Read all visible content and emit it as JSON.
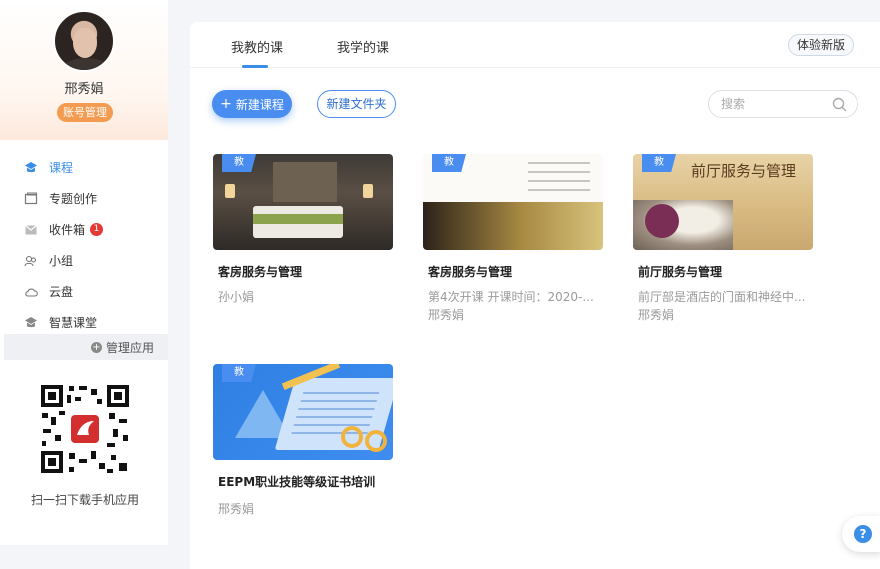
{
  "sidebar": {
    "user": {
      "name": "邢秀娟",
      "account_button": "账号管理"
    },
    "nav": [
      {
        "label": "课程",
        "icon": "course-icon",
        "active": true
      },
      {
        "label": "专题创作",
        "icon": "topic-icon"
      },
      {
        "label": "收件箱",
        "icon": "inbox-icon",
        "badge": "1"
      },
      {
        "label": "小组",
        "icon": "group-icon"
      },
      {
        "label": "云盘",
        "icon": "cloud-icon"
      },
      {
        "label": "智慧课堂",
        "icon": "smart-class-icon"
      }
    ],
    "manage_apps": "管理应用",
    "qr_caption": "扫一扫下载手机应用"
  },
  "header": {
    "tabs": [
      {
        "label": "我教的课",
        "active": true
      },
      {
        "label": "我学的课"
      }
    ],
    "new_version": "体验新版"
  },
  "toolbar": {
    "new_course": "新建课程",
    "new_folder": "新建文件夹",
    "search_placeholder": "搜索"
  },
  "courses": [
    {
      "tag": "教",
      "title": "客房服务与管理",
      "line1": "孙小娟",
      "line2": ""
    },
    {
      "tag": "教",
      "title": "客房服务与管理",
      "line1": "第4次开课   开课时间：2020-...",
      "line2": "邢秀娟"
    },
    {
      "tag": "教",
      "title": "前厅服务与管理",
      "line1": "前厅部是酒店的门面和神经中...",
      "line2": "邢秀娟",
      "cover_title": "前厅服务与管理"
    },
    {
      "tag": "教",
      "title": "EEPM职业技能等级证书培训",
      "line1": "邢秀娟",
      "line2": ""
    }
  ],
  "colors": {
    "accent": "#3a8ee6",
    "account_button": "#f29b51",
    "badge": "#e53935"
  }
}
